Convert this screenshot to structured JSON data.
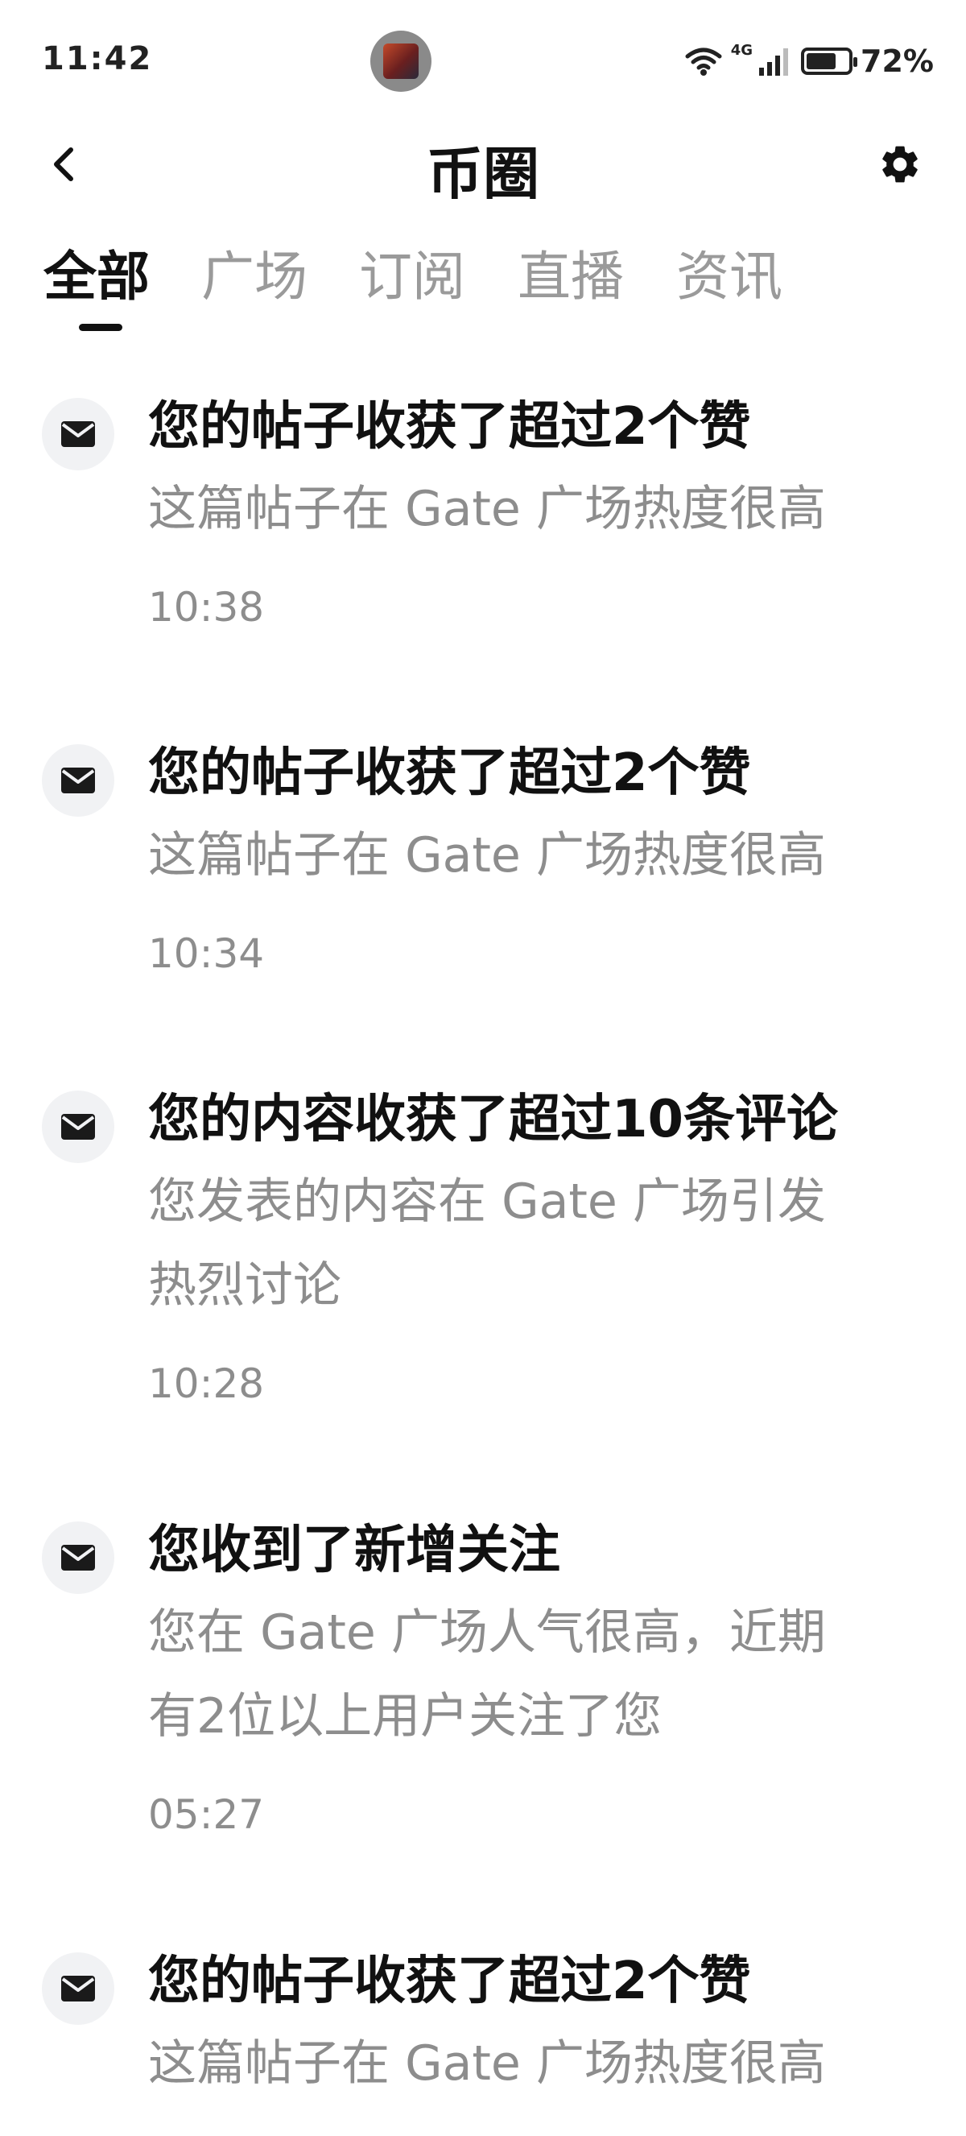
{
  "status": {
    "time": "11:42",
    "network": "4G",
    "battery_percent": "72%",
    "battery_level": 0.72
  },
  "header": {
    "title": "币圈",
    "back_icon": "chevron-left-icon",
    "settings_icon": "gear-icon"
  },
  "tabs": [
    {
      "label": "全部",
      "active": true
    },
    {
      "label": "广场",
      "active": false
    },
    {
      "label": "订阅",
      "active": false
    },
    {
      "label": "直播",
      "active": false
    },
    {
      "label": "资讯",
      "active": false
    }
  ],
  "notifications": [
    {
      "title": "您的帖子收获了超过2个赞",
      "desc_lines": [
        "这篇帖子在 Gate 广场热度很高"
      ],
      "time": "10:38",
      "icon": "mail-icon"
    },
    {
      "title": "您的帖子收获了超过2个赞",
      "desc_lines": [
        "这篇帖子在 Gate 广场热度很高"
      ],
      "time": "10:34",
      "icon": "mail-icon"
    },
    {
      "title": "您的内容收获了超过10条评论",
      "desc_lines": [
        "您发表的内容在 Gate 广场引发",
        "热烈讨论"
      ],
      "time": "10:28",
      "icon": "mail-icon"
    },
    {
      "title": "您收到了新增关注",
      "desc_lines": [
        "您在 Gate 广场人气很高，近期",
        "有2位以上用户关注了您"
      ],
      "time": "05:27",
      "icon": "mail-icon"
    },
    {
      "title": "您的帖子收获了超过2个赞",
      "desc_lines": [
        "这篇帖子在 Gate 广场热度很高"
      ],
      "time": "",
      "icon": "mail-icon"
    }
  ]
}
